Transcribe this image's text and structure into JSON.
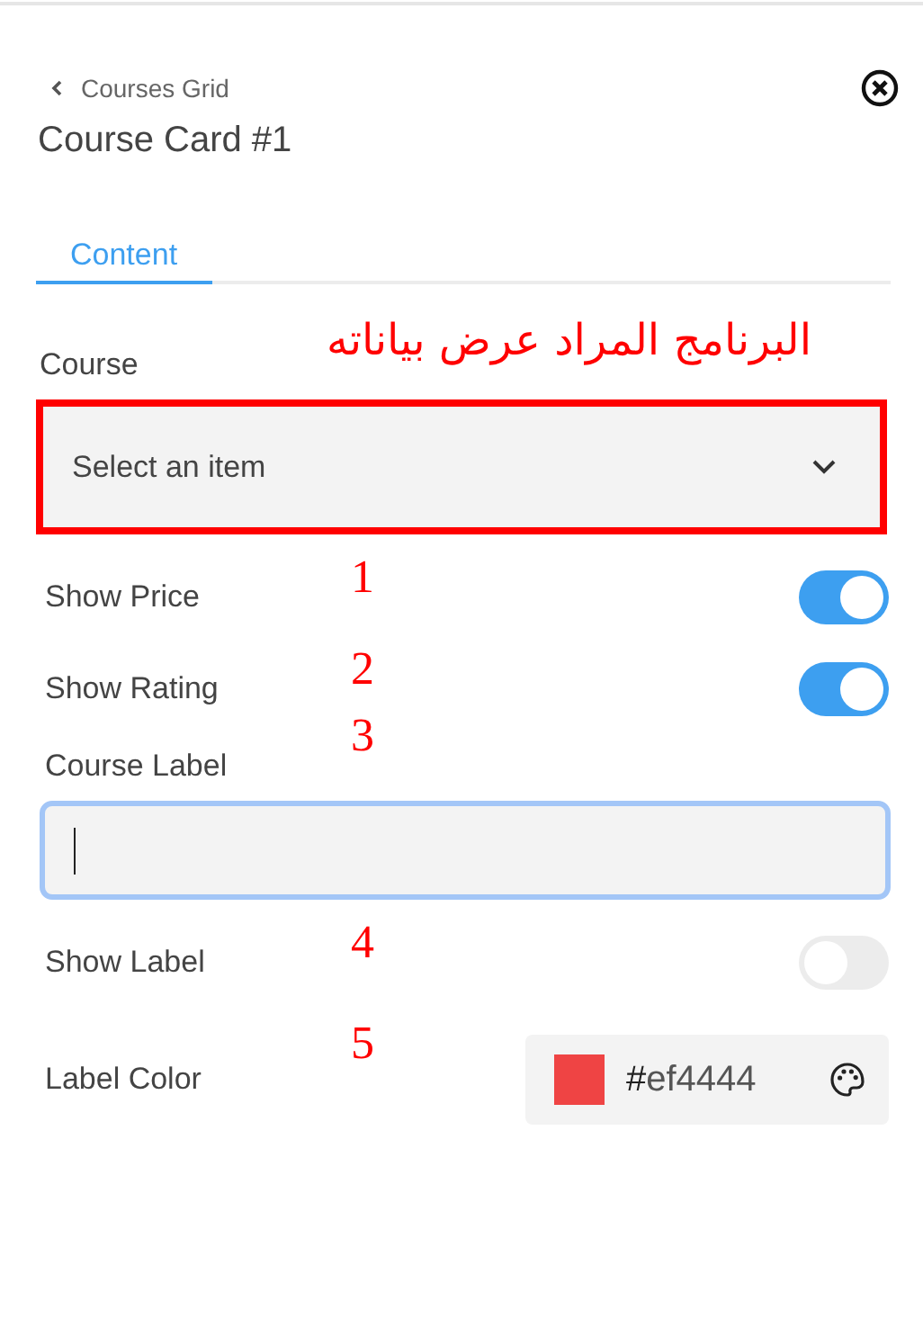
{
  "header": {
    "back_link": "Courses Grid",
    "title": "Course Card #1"
  },
  "tabs": [
    {
      "label": "Content",
      "selected": true
    }
  ],
  "fields": [
    {
      "kind": "select",
      "label": "Course",
      "placeholder": "Select an item",
      "highlighted": true,
      "note": "البرنامج المراد عرض بياناته"
    },
    {
      "kind": "toggle",
      "label": "Show Price",
      "on": true,
      "marker": "1"
    },
    {
      "kind": "toggle",
      "label": "Show Rating",
      "on": true,
      "marker": "2"
    },
    {
      "kind": "text",
      "label": "Course Label",
      "focused": true,
      "marker": "3"
    },
    {
      "kind": "toggle",
      "label": "Show Label",
      "on": false,
      "marker": "4"
    },
    {
      "kind": "color",
      "label": "Label Color",
      "hash": "#",
      "value": "ef4444",
      "color": "#ef4444",
      "marker": "5"
    }
  ]
}
